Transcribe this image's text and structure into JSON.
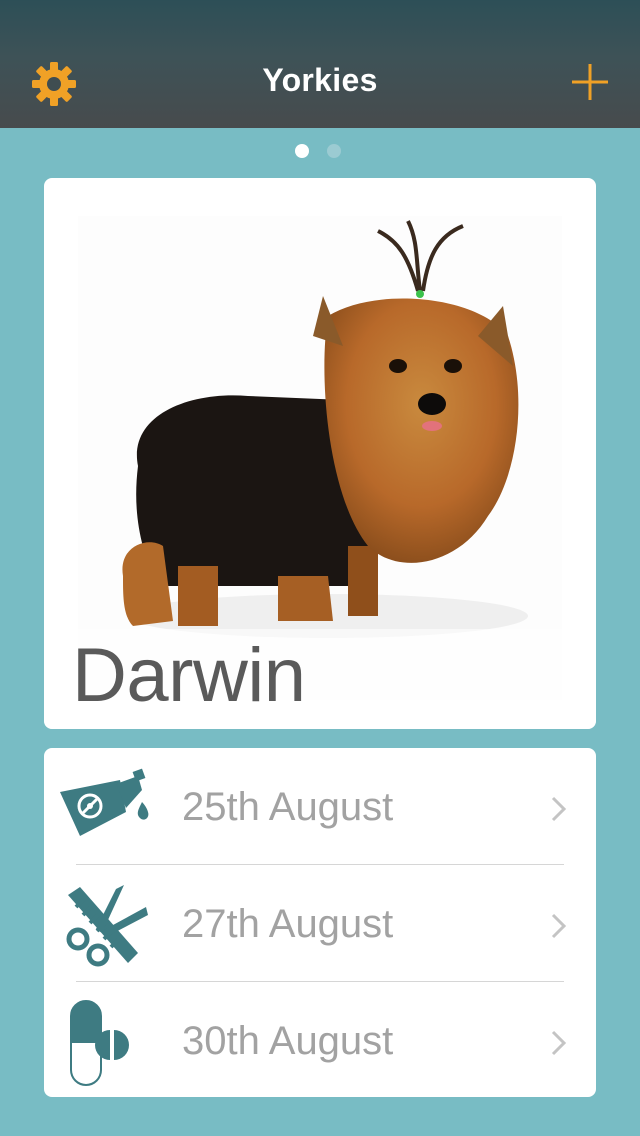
{
  "nav": {
    "title": "Yorkies",
    "left_icon": "gear-icon",
    "right_icon": "plus-icon",
    "accent_color": "#f0a126"
  },
  "pager": {
    "total_pages": 2,
    "current_page": 1
  },
  "pet": {
    "name": "Darwin"
  },
  "reminders": [
    {
      "icon": "flea-treatment-icon",
      "date": "25th August"
    },
    {
      "icon": "grooming-icon",
      "date": "27th August"
    },
    {
      "icon": "medication-icon",
      "date": "30th August"
    }
  ],
  "colors": {
    "icon_teal": "#3e7b82",
    "background": "#78bcc4"
  }
}
